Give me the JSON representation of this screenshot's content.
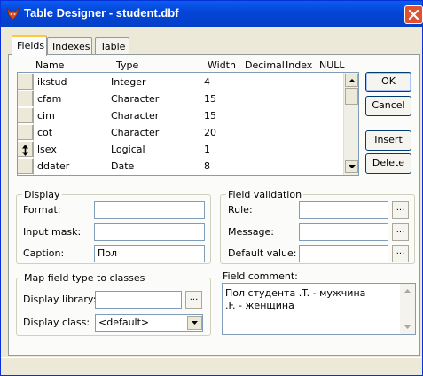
{
  "window": {
    "title": "Table Designer - student.dbf",
    "icon_name": "fox-icon",
    "close_icon": "close-icon"
  },
  "tabs": [
    {
      "label": "Fields",
      "active": true
    },
    {
      "label": "Indexes",
      "active": false
    },
    {
      "label": "Table",
      "active": false
    }
  ],
  "grid": {
    "columns": [
      "Name",
      "Type",
      "Width",
      "Decimal",
      "Index",
      "NULL"
    ],
    "rows": [
      {
        "name": "ikstud",
        "type": "Integer",
        "width": "4"
      },
      {
        "name": "cfam",
        "type": "Character",
        "width": "15"
      },
      {
        "name": "cim",
        "type": "Character",
        "width": "15"
      },
      {
        "name": "cot",
        "type": "Character",
        "width": "20"
      },
      {
        "name": "lsex",
        "type": "Logical",
        "width": "1"
      },
      {
        "name": "ddater",
        "type": "Date",
        "width": "8"
      }
    ],
    "current_row_icon": "move-updown-icon"
  },
  "buttons": {
    "ok": "OK",
    "cancel": "Cancel",
    "insert": "Insert",
    "delete": "Delete"
  },
  "display": {
    "legend": "Display",
    "format_label": "Format:",
    "format_value": "",
    "input_mask_label": "Input mask:",
    "input_mask_value": "",
    "caption_label": "Caption:",
    "caption_value": "Пол"
  },
  "validation": {
    "legend": "Field validation",
    "rule_label": "Rule:",
    "rule_value": "",
    "message_label": "Message:",
    "message_value": "",
    "default_label": "Default value:",
    "default_value": "",
    "builder_label": "..."
  },
  "map": {
    "legend": "Map field type to classes",
    "library_label": "Display library:",
    "library_value": "",
    "class_label": "Display class:",
    "class_value": "<default>",
    "builder_label": "..."
  },
  "comment": {
    "label": "Field comment:",
    "line1": "Пол студента .T. - мужчина",
    "line2": ".F. - женщина"
  }
}
